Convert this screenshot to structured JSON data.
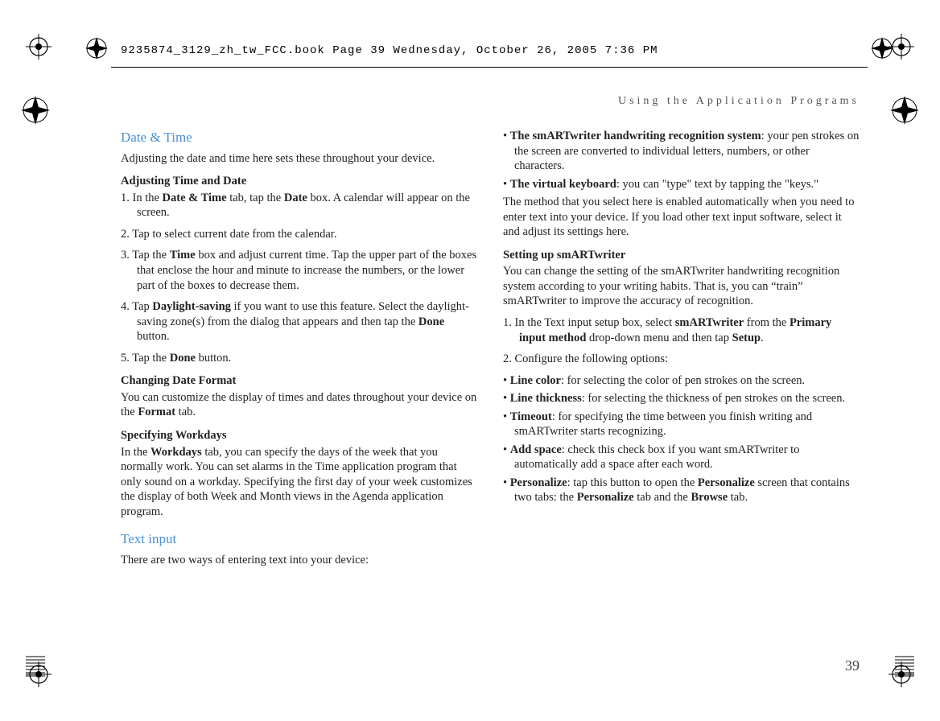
{
  "header": "9235874_3129_zh_tw_FCC.book  Page 39  Wednesday, October 26, 2005  7:36 PM",
  "running_head": "Using the Application Programs",
  "page_number": "39",
  "left": {
    "h1": "Date & Time",
    "p1": "Adjusting the date and time here sets these throughout your device.",
    "h2": "Adjusting Time and Date",
    "s1a": "1. In the ",
    "s1b": "Date & Time",
    "s1c": " tab, tap the ",
    "s1d": "Date",
    "s1e": " box. A calendar will appear on the screen.",
    "s2": "2. Tap to select current date from the calendar.",
    "s3a": "3. Tap the ",
    "s3b": "Time",
    "s3c": " box and adjust current time. Tap the upper part of the boxes that enclose the hour and minute to increase the numbers, or the lower part of the boxes to decrease them.",
    "s4a": "4. Tap ",
    "s4b": "Daylight-saving",
    "s4c": " if you want to use this feature. Select the daylight-saving zone(s) from the dialog that appears and then tap the ",
    "s4d": "Done",
    "s4e": " button.",
    "s5a": "5. Tap the ",
    "s5b": "Done",
    "s5c": " button.",
    "h3": "Changing Date Format",
    "p2a": "You can customize the display of times and dates throughout your device on the ",
    "p2b": "Format",
    "p2c": " tab.",
    "h4": "Specifying Workdays",
    "p3a": "In the ",
    "p3b": "Workdays",
    "p3c": " tab, you can specify the days of the week that you normally work. You can set alarms in the Time application program that only sound on a workday. Specifying the first day of your week customizes the display of both Week and Month views in the Agenda application program.",
    "h5": "Text input",
    "p4": "There are two ways of entering text into your device:"
  },
  "right": {
    "b1a": "• ",
    "b1b": "The smARTwriter handwriting recognition system",
    "b1c": ": your pen strokes on the screen are converted to individual letters, numbers, or other characters.",
    "b2a": "• ",
    "b2b": "The virtual keyboard",
    "b2c": ": you can \"type\" text by tapping the \"keys.\"",
    "p1": "The method that you select here is enabled automatically when you need to enter text into your device. If you load other text input software, select it and adjust its settings here.",
    "h1": "Setting up smARTwriter",
    "p2": "You can change the setting of the smARTwriter handwriting recognition system according to your writing habits. That is, you can “train” smARTwriter to improve the accuracy of recognition.",
    "s1a": "1. In the Text input setup box, select ",
    "s1b": "smARTwriter",
    "s1c": " from the ",
    "s1d": "Primary input method",
    "s1e": " drop-down menu and then tap ",
    "s1f": "Setup",
    "s1g": ".",
    "s2": "2. Configure the following options:",
    "b3a": "• ",
    "b3b": "Line color",
    "b3c": ": for selecting the color of pen strokes on the screen.",
    "b4a": "• ",
    "b4b": "Line thickness",
    "b4c": ": for selecting the thickness of pen strokes on the screen.",
    "b5a": "• ",
    "b5b": "Timeout",
    "b5c": ": for specifying the time between you finish writing and smARTwriter starts recognizing.",
    "b6a": "• ",
    "b6b": "Add space",
    "b6c": ": check this check box if you want smARTwriter to automatically add a space after each word.",
    "b7a": "• ",
    "b7b": "Personalize",
    "b7c": ": tap this button to open the ",
    "b7d": "Personalize",
    "b7e": " screen that contains two tabs: the ",
    "b7f": "Personalize",
    "b7g": " tab and the ",
    "b7h": "Browse",
    "b7i": " tab."
  }
}
